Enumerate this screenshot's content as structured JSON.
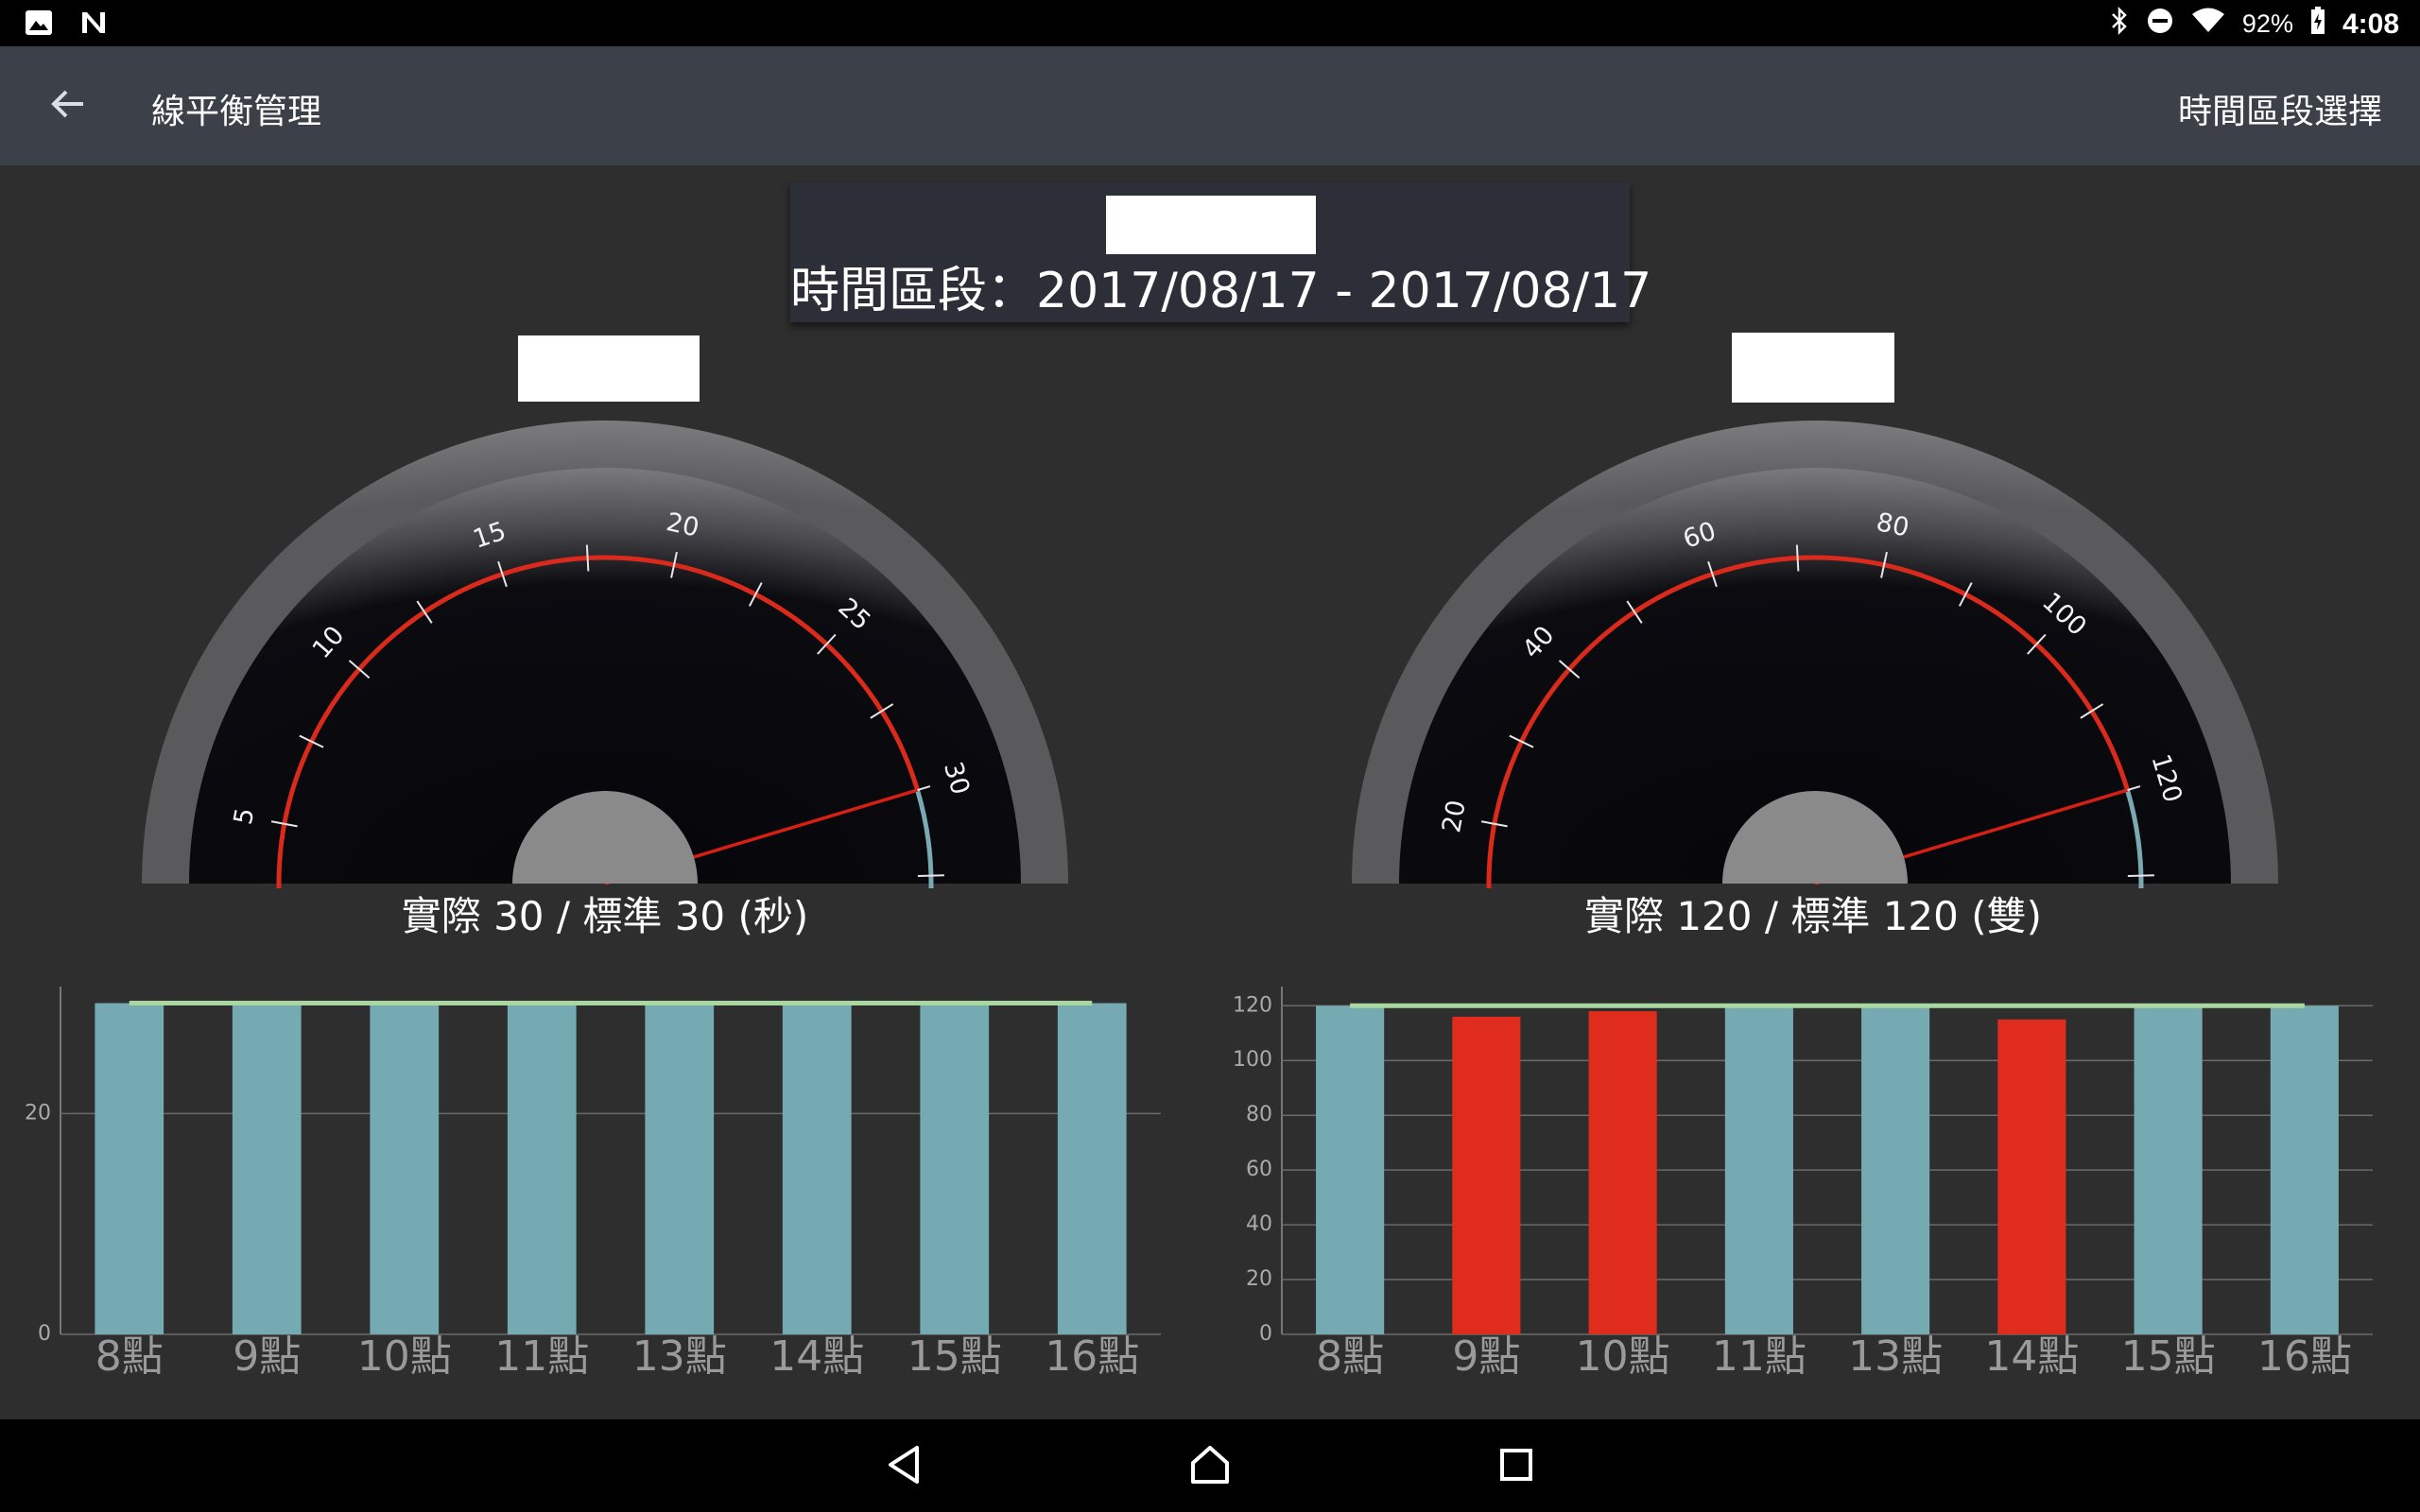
{
  "status_bar": {
    "battery": "92%",
    "time": "4:08",
    "icons": [
      "image-icon",
      "n-app-icon",
      "bluetooth-icon",
      "do-not-disturb-icon",
      "wifi-icon",
      "battery-charging-icon"
    ]
  },
  "toolbar": {
    "back_icon": "arrow-back-icon",
    "title": "線平衡管理",
    "action": "時間區段選擇"
  },
  "period": {
    "text": "時間區段：2017/08/17 - 2017/08/17"
  },
  "gauges": [
    {
      "label": "實際 30 / 標準 30 (秒)",
      "value": 30,
      "max": 36,
      "standard": 30,
      "major_ticks": [
        0,
        5,
        10,
        15,
        20,
        25,
        30,
        35
      ],
      "minor_step": 2.5,
      "red_color": "#d92a1c",
      "blue_color": "#7aa9b2"
    },
    {
      "label": "實際 120 / 標準 120 (雙)",
      "value": 120,
      "max": 144,
      "standard": 120,
      "major_ticks": [
        0,
        20,
        40,
        60,
        80,
        100,
        120,
        140
      ],
      "minor_step": 10,
      "red_color": "#d92a1c",
      "blue_color": "#7aa9b2"
    }
  ],
  "chart_data": [
    {
      "type": "bar",
      "categories": [
        "8點",
        "9點",
        "10點",
        "11點",
        "13點",
        "14點",
        "15點",
        "16點"
      ],
      "values": [
        30,
        30,
        30,
        30,
        30,
        30,
        30,
        30
      ],
      "standard": 30,
      "ylim": [
        0,
        31.5
      ],
      "yticks": [
        0,
        20
      ],
      "colors": [
        "#75aab2",
        "#75aab2",
        "#75aab2",
        "#75aab2",
        "#75aab2",
        "#75aab2",
        "#75aab2",
        "#75aab2"
      ],
      "standard_color": "#a8d8a0",
      "grid": true
    },
    {
      "type": "bar",
      "categories": [
        "8點",
        "9點",
        "10點",
        "11點",
        "13點",
        "14點",
        "15點",
        "16點"
      ],
      "values": [
        120,
        116,
        118,
        120,
        120,
        115,
        120,
        120
      ],
      "standard": 120,
      "ylim": [
        0,
        127
      ],
      "yticks": [
        0,
        20,
        40,
        60,
        80,
        100,
        120
      ],
      "colors": [
        "#75aab2",
        "#df2c1c",
        "#df2c1c",
        "#75aab2",
        "#75aab2",
        "#df2c1c",
        "#75aab2",
        "#75aab2"
      ],
      "standard_color": "#a8d8a0",
      "grid": true
    }
  ],
  "navbar": {
    "icons": [
      "back-triangle-icon",
      "home-icon",
      "recents-icon"
    ]
  }
}
